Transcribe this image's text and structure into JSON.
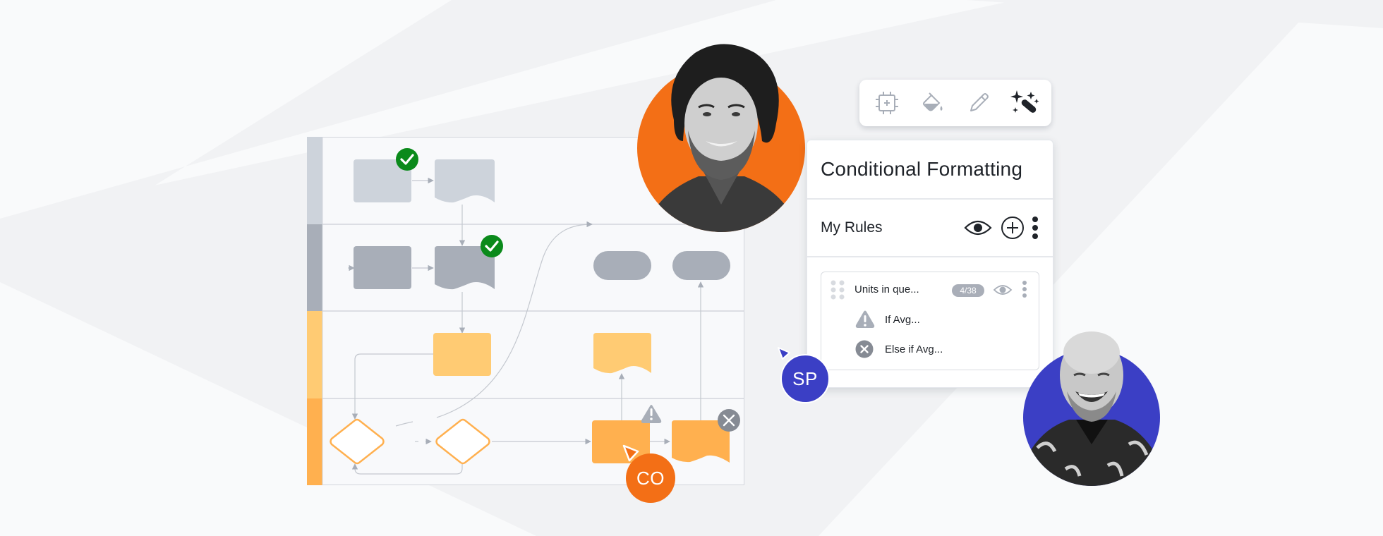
{
  "colors": {
    "background": "#f9fafb",
    "bg_shape": "#f1f2f4",
    "lane_1": "#cdd3db",
    "lane_2": "#a8aeb8",
    "lane_3": "#ffcb73",
    "lane_4": "#ffb04f",
    "success": "#0b8a1b",
    "warning": "#a8aeb8",
    "error": "#868b94",
    "accent_orange": "#f36f16",
    "accent_blue": "#3b3fc5",
    "text_dark": "#1f2329"
  },
  "toolbar": {
    "tools": [
      {
        "icon": "crosshair-frame-icon",
        "label": "Frame",
        "active": false
      },
      {
        "icon": "paint-bucket-icon",
        "label": "Fill",
        "active": false
      },
      {
        "icon": "pencil-icon",
        "label": "Edit",
        "active": false
      },
      {
        "icon": "magic-wand-icon",
        "label": "Conditional formatting",
        "active": true
      }
    ]
  },
  "panel": {
    "title": "Conditional Formatting",
    "rules_section_title": "My Rules",
    "header_actions": [
      "eye-icon",
      "add-circle-icon",
      "more-vertical-icon"
    ],
    "rules": [
      {
        "name": "Units in que...",
        "count": "4/38",
        "conditions": [
          {
            "icon": "warning-icon",
            "text": "If Avg..."
          },
          {
            "icon": "error-circle-icon",
            "text": "Else if Avg..."
          }
        ]
      }
    ]
  },
  "diagram": {
    "lanes": 4,
    "status_markers": [
      {
        "type": "success",
        "icon": "check-circle-icon"
      },
      {
        "type": "success",
        "icon": "check-circle-icon"
      },
      {
        "type": "warning",
        "icon": "warning-icon"
      },
      {
        "type": "error",
        "icon": "close-circle-icon"
      }
    ]
  },
  "collaborators": [
    {
      "initials": "CO",
      "color": "#f36f16"
    },
    {
      "initials": "SP",
      "color": "#3b3fc5"
    }
  ],
  "people": [
    {
      "description": "Man with curly hair, smiling",
      "ring_color": "#f36f16"
    },
    {
      "description": "Bald man laughing, floral shirt",
      "ring_color": "#3b3fc5"
    }
  ]
}
